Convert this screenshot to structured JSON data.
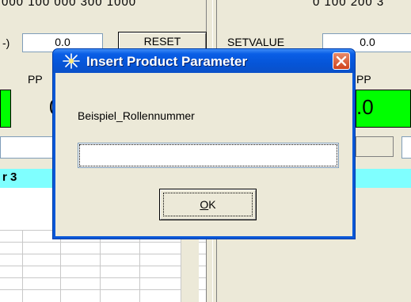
{
  "background": {
    "left_scale": "000   100   000   300  1000",
    "right_scale": "0     100   200   3",
    "reset_label": "RESET",
    "left_value": "0.0",
    "left_paren": "-)",
    "left_pp": "PP",
    "left_green_value": "0",
    "setvalue_label": "SETVALUE",
    "right_value": "0.0",
    "right_pp": "PP",
    "right_green_value": ".0",
    "panel_title": "r 3"
  },
  "dialog": {
    "title": "Insert Product Parameter",
    "prompt": "Beispiel_Rollennummer",
    "input_value": "",
    "ok_label": "OK",
    "icon": "sparkle-icon",
    "close_icon": "close-icon"
  },
  "colors": {
    "title_bar": "#0a5ee6",
    "status_green": "#00ff00",
    "header_cyan": "#7fffff",
    "close_red": "#d0431c"
  }
}
